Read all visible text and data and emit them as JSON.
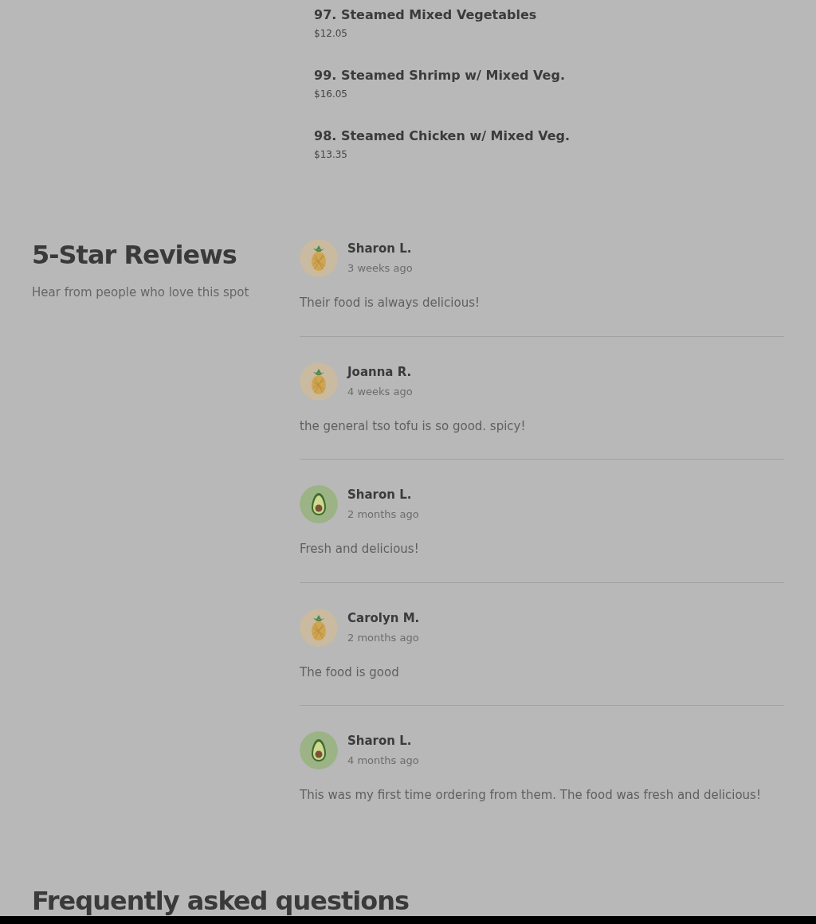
{
  "menu_items": [
    {
      "name": "97. Steamed Mixed Vegetables",
      "price": "$12.05"
    },
    {
      "name": "99. Steamed Shrimp w/ Mixed Veg.",
      "price": "$16.05"
    },
    {
      "name": "98. Steamed Chicken w/ Mixed Veg.",
      "price": "$13.35"
    }
  ],
  "reviews_section": {
    "title": "5-Star Reviews",
    "subtitle": "Hear from people who love this spot"
  },
  "reviews": [
    {
      "avatar": {
        "kind": "pineapple"
      },
      "author": "Sharon L.",
      "time": "3 weeks ago",
      "text": "Their food is always delicious!"
    },
    {
      "avatar": {
        "kind": "pineapple"
      },
      "author": "Joanna R.",
      "time": "4 weeks ago",
      "text": "the general tso tofu is so good. spicy!"
    },
    {
      "avatar": {
        "kind": "avocado"
      },
      "author": "Sharon L.",
      "time": "2 months ago",
      "text": "Fresh and delicious!"
    },
    {
      "avatar": {
        "kind": "pineapple"
      },
      "author": "Carolyn M.",
      "time": "2 months ago",
      "text": "The food is good"
    },
    {
      "avatar": {
        "kind": "avocado"
      },
      "author": "Sharon L.",
      "time": "4 months ago",
      "text": "This was my first time ordering from them. The food was fresh and delicious!"
    }
  ],
  "faq": {
    "title": "Frequently asked questions"
  }
}
